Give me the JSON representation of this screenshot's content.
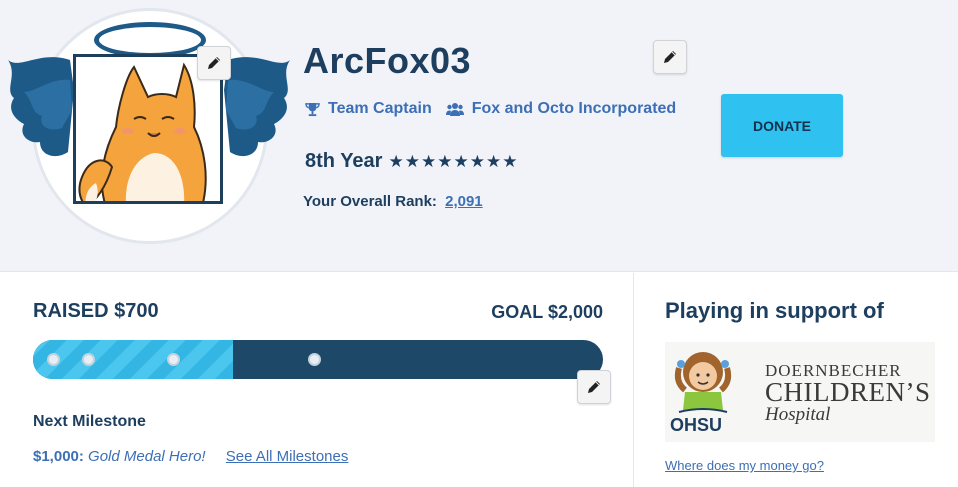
{
  "profile": {
    "username": "ArcFox03",
    "role": "Team Captain",
    "team": "Fox and Octo Incorporated",
    "year": "8th Year",
    "stars": [
      "★",
      "★",
      "★",
      "★",
      "★",
      "★",
      "★",
      "★"
    ],
    "rank_label": "Your Overall Rank:",
    "rank_value": "2,091"
  },
  "donate_label": "DONATE",
  "fundraising": {
    "raised_label": "RAISED $700",
    "goal_label": "GOAL $2,000",
    "progress_fraction": 0.35,
    "next_milestone_label": "Next Milestone",
    "milestone_amount": "$1,000:",
    "milestone_name": "Gold Medal Hero!",
    "see_all_label": "See All Milestones"
  },
  "support": {
    "title": "Playing in support of",
    "logo_ohsu": "OHSU",
    "logo_line1": "DOERNBECHER",
    "logo_line2": "CHILDREN’S",
    "logo_line3": "Hospital",
    "money_link": "Where does my money go?"
  },
  "colors": {
    "navy": "#1d3e5e",
    "link_blue": "#3c6fb5",
    "donate_cyan": "#2fc1ef",
    "bar_dark": "#1e4868",
    "bar_fill": "#4bc6ee"
  },
  "icons": [
    "pencil-icon",
    "trophy-icon",
    "users-icon",
    "star-icon"
  ]
}
